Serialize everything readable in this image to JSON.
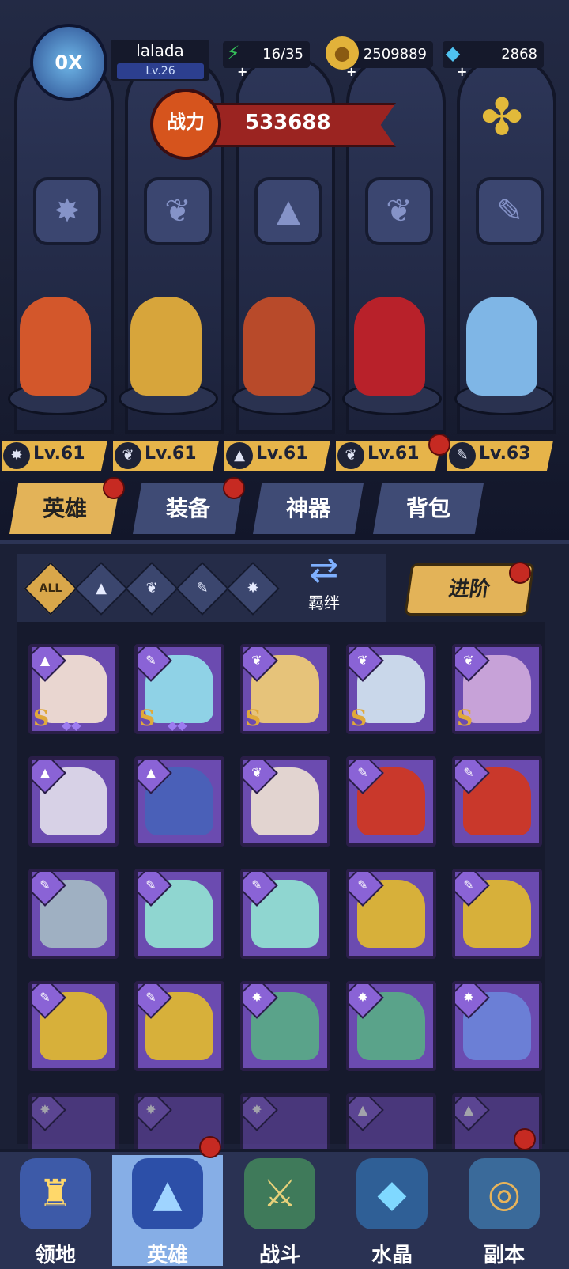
{
  "player": {
    "name": "lalada",
    "level": "Lv.26",
    "avatar_badge": "0X"
  },
  "resources": {
    "stamina": "16/35",
    "gold": "2509889",
    "gems": "2868"
  },
  "combat_power": {
    "label": "战力",
    "value": "533688"
  },
  "class_emblems": [
    "claw-emblem",
    "wing-emblem",
    "wizard-hat-emblem",
    "wing-emblem",
    "wrench-emblem"
  ],
  "team": [
    {
      "level": "Lv.61",
      "class_icon": "claw",
      "color": "#d3572b"
    },
    {
      "level": "Lv.61",
      "class_icon": "wing",
      "color": "#d7a53b"
    },
    {
      "level": "Lv.61",
      "class_icon": "hat",
      "color": "#b84a2a"
    },
    {
      "level": "Lv.61",
      "class_icon": "wing",
      "color": "#b8212a"
    },
    {
      "level": "Lv.63",
      "class_icon": "wrench",
      "color": "#7fb6e6"
    }
  ],
  "tabs": [
    "英雄",
    "装备",
    "神器",
    "背包"
  ],
  "filters": {
    "all": "ALL",
    "bond": "羁绊",
    "advance": "进阶"
  },
  "roster_rows": [
    [
      {
        "class": "hat",
        "rank": "S",
        "color": "#e9d6d0"
      },
      {
        "class": "wrench",
        "rank": "S",
        "color": "#8fd2e6"
      },
      {
        "class": "wing",
        "rank": "S",
        "color": "#e6c37a"
      },
      {
        "class": "wing",
        "rank": "S",
        "color": "#c9d7ea"
      },
      {
        "class": "wing",
        "rank": "S",
        "color": "#c7a2d8"
      }
    ],
    [
      {
        "class": "hat",
        "rank": "",
        "color": "#d7d1e6"
      },
      {
        "class": "hat",
        "rank": "",
        "color": "#4a60b8"
      },
      {
        "class": "wing",
        "rank": "",
        "color": "#e2d4d0"
      },
      {
        "class": "wrench",
        "rank": "",
        "color": "#c9382b"
      },
      {
        "class": "wrench",
        "rank": "",
        "color": "#c9382b"
      }
    ],
    [
      {
        "class": "wrench",
        "rank": "",
        "color": "#9fb0c2"
      },
      {
        "class": "wrench",
        "rank": "",
        "color": "#8fd6d0"
      },
      {
        "class": "wrench",
        "rank": "",
        "color": "#8fd6d0"
      },
      {
        "class": "wrench",
        "rank": "",
        "color": "#d7b03a"
      },
      {
        "class": "wrench",
        "rank": "",
        "color": "#d7b03a"
      }
    ],
    [
      {
        "class": "wrench",
        "rank": "",
        "color": "#d7b03a"
      },
      {
        "class": "wrench",
        "rank": "",
        "color": "#d7b03a"
      },
      {
        "class": "claw",
        "rank": "",
        "color": "#5aa38a"
      },
      {
        "class": "claw",
        "rank": "",
        "color": "#5aa38a"
      },
      {
        "class": "claw",
        "rank": "",
        "color": "#6b7fd6"
      }
    ]
  ],
  "nav": [
    {
      "label": "领地",
      "icon": "castle-icon"
    },
    {
      "label": "英雄",
      "icon": "wizard-hat-icon"
    },
    {
      "label": "战斗",
      "icon": "sword-icon"
    },
    {
      "label": "水晶",
      "icon": "crystal-icon"
    },
    {
      "label": "副本",
      "icon": "portal-icon"
    }
  ],
  "colors": {
    "accent": "#e3b358",
    "panel": "#1b2036",
    "card": "#6b4bb0",
    "notify": "#c62a22"
  }
}
